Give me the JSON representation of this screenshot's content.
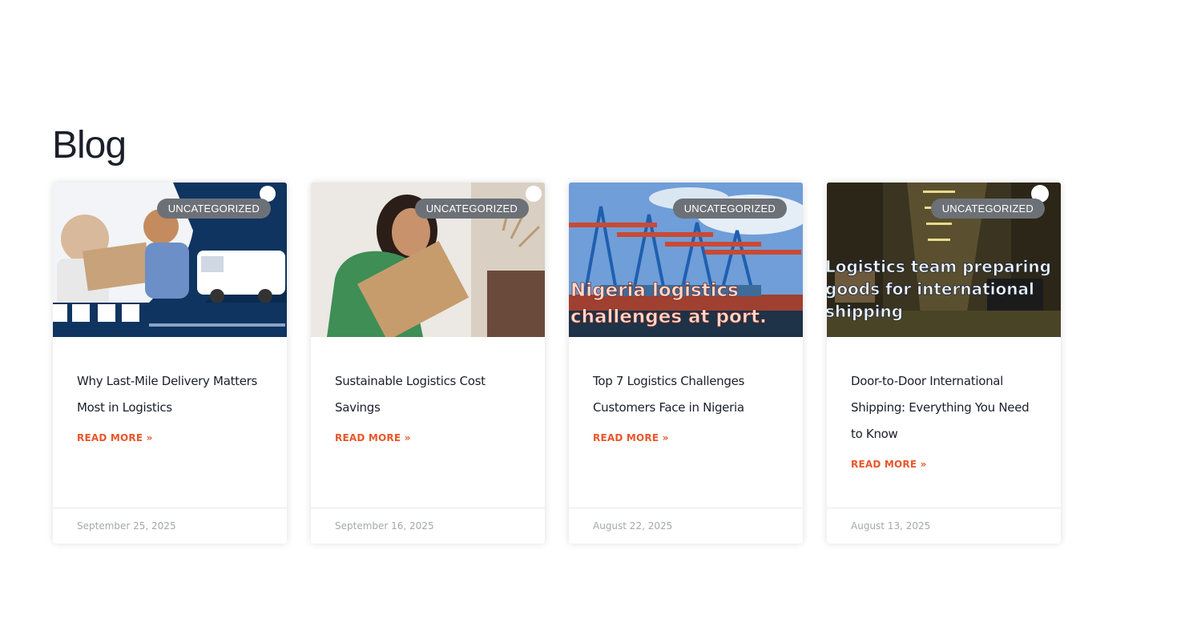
{
  "page": {
    "title": "Blog"
  },
  "posts": [
    {
      "category": "UNCATEGORIZED",
      "title": "Why Last-Mile Delivery Matters Most in Logistics",
      "read_more": "READ MORE »",
      "date": "September 25, 2025",
      "image": {
        "subject": "delivery-handoff-van"
      }
    },
    {
      "category": "UNCATEGORIZED",
      "title": "Sustainable Logistics Cost Savings",
      "read_more": "READ MORE »",
      "date": "September 16, 2025",
      "image": {
        "subject": "woman-hugging-package"
      }
    },
    {
      "category": "UNCATEGORIZED",
      "title": "Top 7 Logistics Challenges Customers Face in Nigeria",
      "read_more": "READ MORE »",
      "date": "August 22, 2025",
      "image": {
        "subject": "port-cranes-container-ship",
        "overlay_lines": [
          "Nigeria logistics",
          "challenges at port."
        ]
      }
    },
    {
      "category": "UNCATEGORIZED",
      "title": "Door-to-Door International Shipping: Everything You Need to Know",
      "read_more": "READ MORE »",
      "date": "August 13, 2025",
      "image": {
        "subject": "warehouse-trucks",
        "overlay_lines": [
          "Logistics team preparing",
          "goods for international",
          "shipping"
        ]
      }
    }
  ],
  "colors": {
    "accent": "#e8572a",
    "badge_bg": "#6c7177",
    "title_text": "#1b1f2a",
    "date_text": "#a5a8ad"
  }
}
